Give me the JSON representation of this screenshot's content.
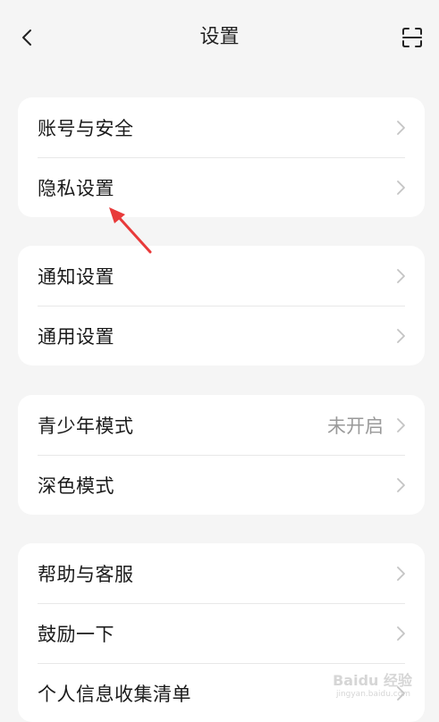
{
  "header": {
    "title": "设置",
    "back_icon": "chevron-left-icon",
    "scan_icon": "scan-icon"
  },
  "groups": [
    {
      "items": [
        {
          "label": "账号与安全",
          "value": ""
        },
        {
          "label": "隐私设置",
          "value": ""
        }
      ]
    },
    {
      "items": [
        {
          "label": "通知设置",
          "value": ""
        },
        {
          "label": "通用设置",
          "value": ""
        }
      ]
    },
    {
      "items": [
        {
          "label": "青少年模式",
          "value": "未开启"
        },
        {
          "label": "深色模式",
          "value": ""
        }
      ]
    },
    {
      "items": [
        {
          "label": "帮助与客服",
          "value": ""
        },
        {
          "label": "鼓励一下",
          "value": ""
        },
        {
          "label": "个人信息收集清单",
          "value": ""
        }
      ]
    }
  ],
  "annotation_arrow_color": "#e83a3a",
  "watermark": {
    "brand": "Baidu 经验",
    "sub": "jingyan.baidu.com"
  }
}
